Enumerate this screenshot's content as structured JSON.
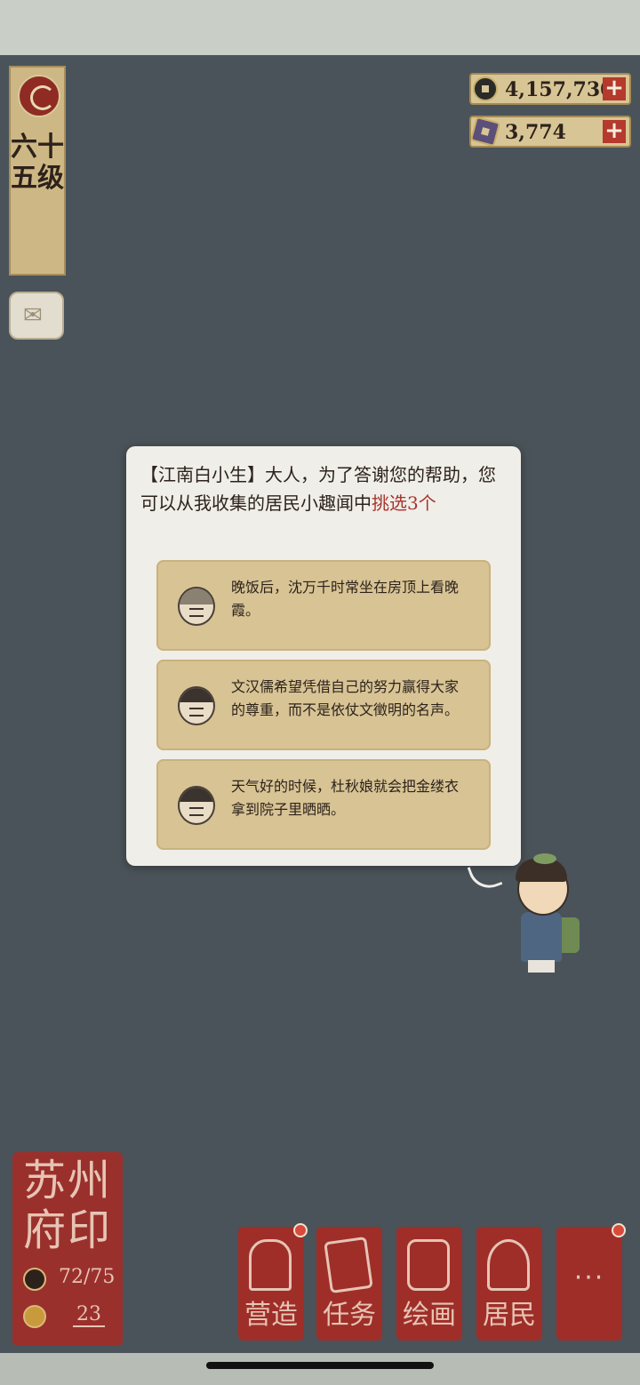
{
  "level": {
    "text": "六十五级"
  },
  "currency": {
    "coins": "4,157,730",
    "gems": "3,774",
    "add_label": "+"
  },
  "dialog": {
    "speaker": "【江南白小生】",
    "text": "大人，为了答谢您的帮助，您可以从我收集的居民小趣闻中",
    "highlight": "挑选3个",
    "rumors": [
      {
        "avatar": "woman-headscarf-icon",
        "text": "晚饭后，沈万千时常坐在房顶上看晚霞。"
      },
      {
        "avatar": "scholar-hat-icon",
        "text": "文汉儒希望凭借自己的努力赢得大家的尊重，而不是依仗文徵明的名声。"
      },
      {
        "avatar": "woman-bun-icon",
        "text": "天气好的时候，杜秋娘就会把金缕衣拿到院子里晒晒。"
      }
    ]
  },
  "seal": {
    "title": "苏州府印",
    "population": "72/75",
    "happiness": "23"
  },
  "menu": {
    "items": [
      {
        "label": "营造",
        "icon": "build-icon"
      },
      {
        "label": "任务",
        "icon": "task-icon"
      },
      {
        "label": "绘画",
        "icon": "paint-icon"
      },
      {
        "label": "居民",
        "icon": "resident-icon"
      }
    ],
    "more_label": "···"
  },
  "colors": {
    "accent_red": "#a8332b",
    "seal_red": "#a82a24",
    "panel_tan": "#d7c394"
  }
}
